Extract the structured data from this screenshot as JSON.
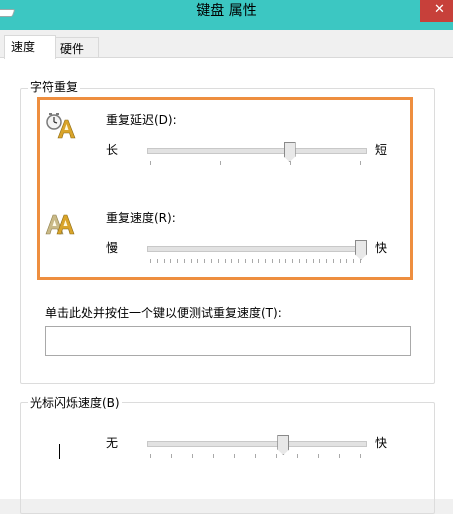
{
  "window": {
    "title": "键盘 属性",
    "close_glyph": "✕"
  },
  "tabs": [
    {
      "label": "速度",
      "active": true
    },
    {
      "label": "硬件",
      "active": false
    }
  ],
  "char_repeat": {
    "group_title": "字符重复",
    "delay": {
      "label": "重复延迟(D):",
      "min_label": "长",
      "max_label": "短",
      "level": 0.66,
      "tick_count": 4
    },
    "rate": {
      "label": "重复速度(R):",
      "min_label": "慢",
      "max_label": "快",
      "level": 1.0,
      "tick_count": 32
    },
    "test": {
      "label": "单击此处并按住一个键以便测试重复速度(T):",
      "value": ""
    }
  },
  "cursor_blink": {
    "group_title": "光标闪烁速度(B)",
    "min_label": "无",
    "max_label": "快",
    "level": 0.63,
    "tick_count": 11
  },
  "icons": {
    "delay": "clock-letter-a-icon",
    "rate": "double-letter-a-icon",
    "cursor": "text-cursor-icon"
  },
  "colors": {
    "titlebar": "#3cc7c2",
    "close_button": "#c7403a",
    "highlight_border": "#ee8e3f"
  }
}
